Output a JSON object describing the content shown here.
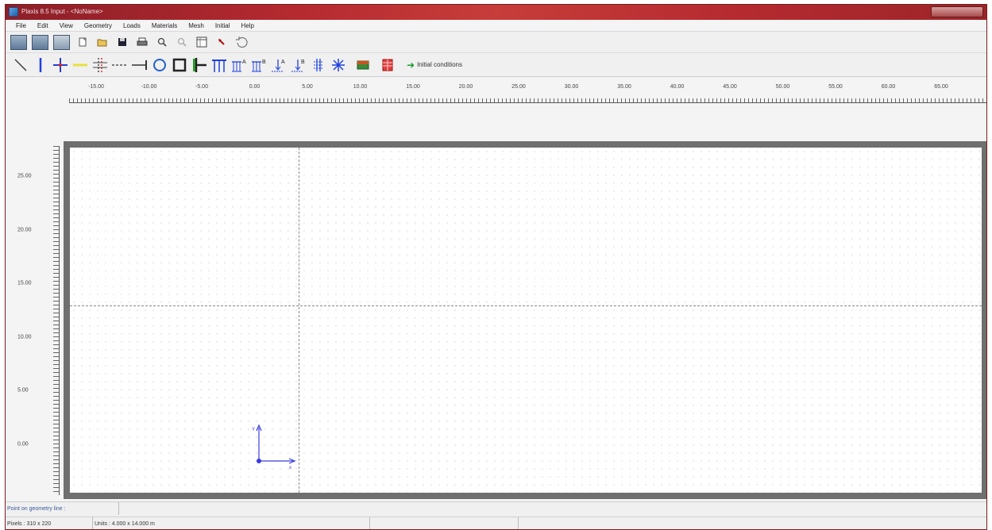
{
  "window": {
    "title": "Plaxis 8.5 Input - <NoName>"
  },
  "menu": [
    "File",
    "Edit",
    "View",
    "Geometry",
    "Loads",
    "Materials",
    "Mesh",
    "Initial",
    "Help"
  ],
  "toolbar2": {
    "initial_conditions_label": "Initial conditions"
  },
  "rulers": {
    "x_labels": [
      "-15.00",
      "-10.00",
      "-5.00",
      "0.00",
      "5.00",
      "10.00",
      "15.00",
      "20.00",
      "25.00",
      "30.00",
      "35.00",
      "40.00",
      "45.00",
      "50.00",
      "55.00",
      "60.00",
      "65.00"
    ],
    "y_labels": [
      "25.00",
      "20.00",
      "15.00",
      "10.00",
      "5.00",
      "0.00"
    ]
  },
  "axes": {
    "x_label": "x",
    "y_label": "Y"
  },
  "status": {
    "point_label": "Point on geometry line :",
    "point_value": "",
    "pixels": "Pixels : 310 x 220",
    "units": "Units : 4.000 x 14.000 m"
  },
  "colors": {
    "title_bar": "#b52a2f",
    "axis_blue": "#3a3ae0",
    "draw_frame": "#6f6f6f"
  }
}
